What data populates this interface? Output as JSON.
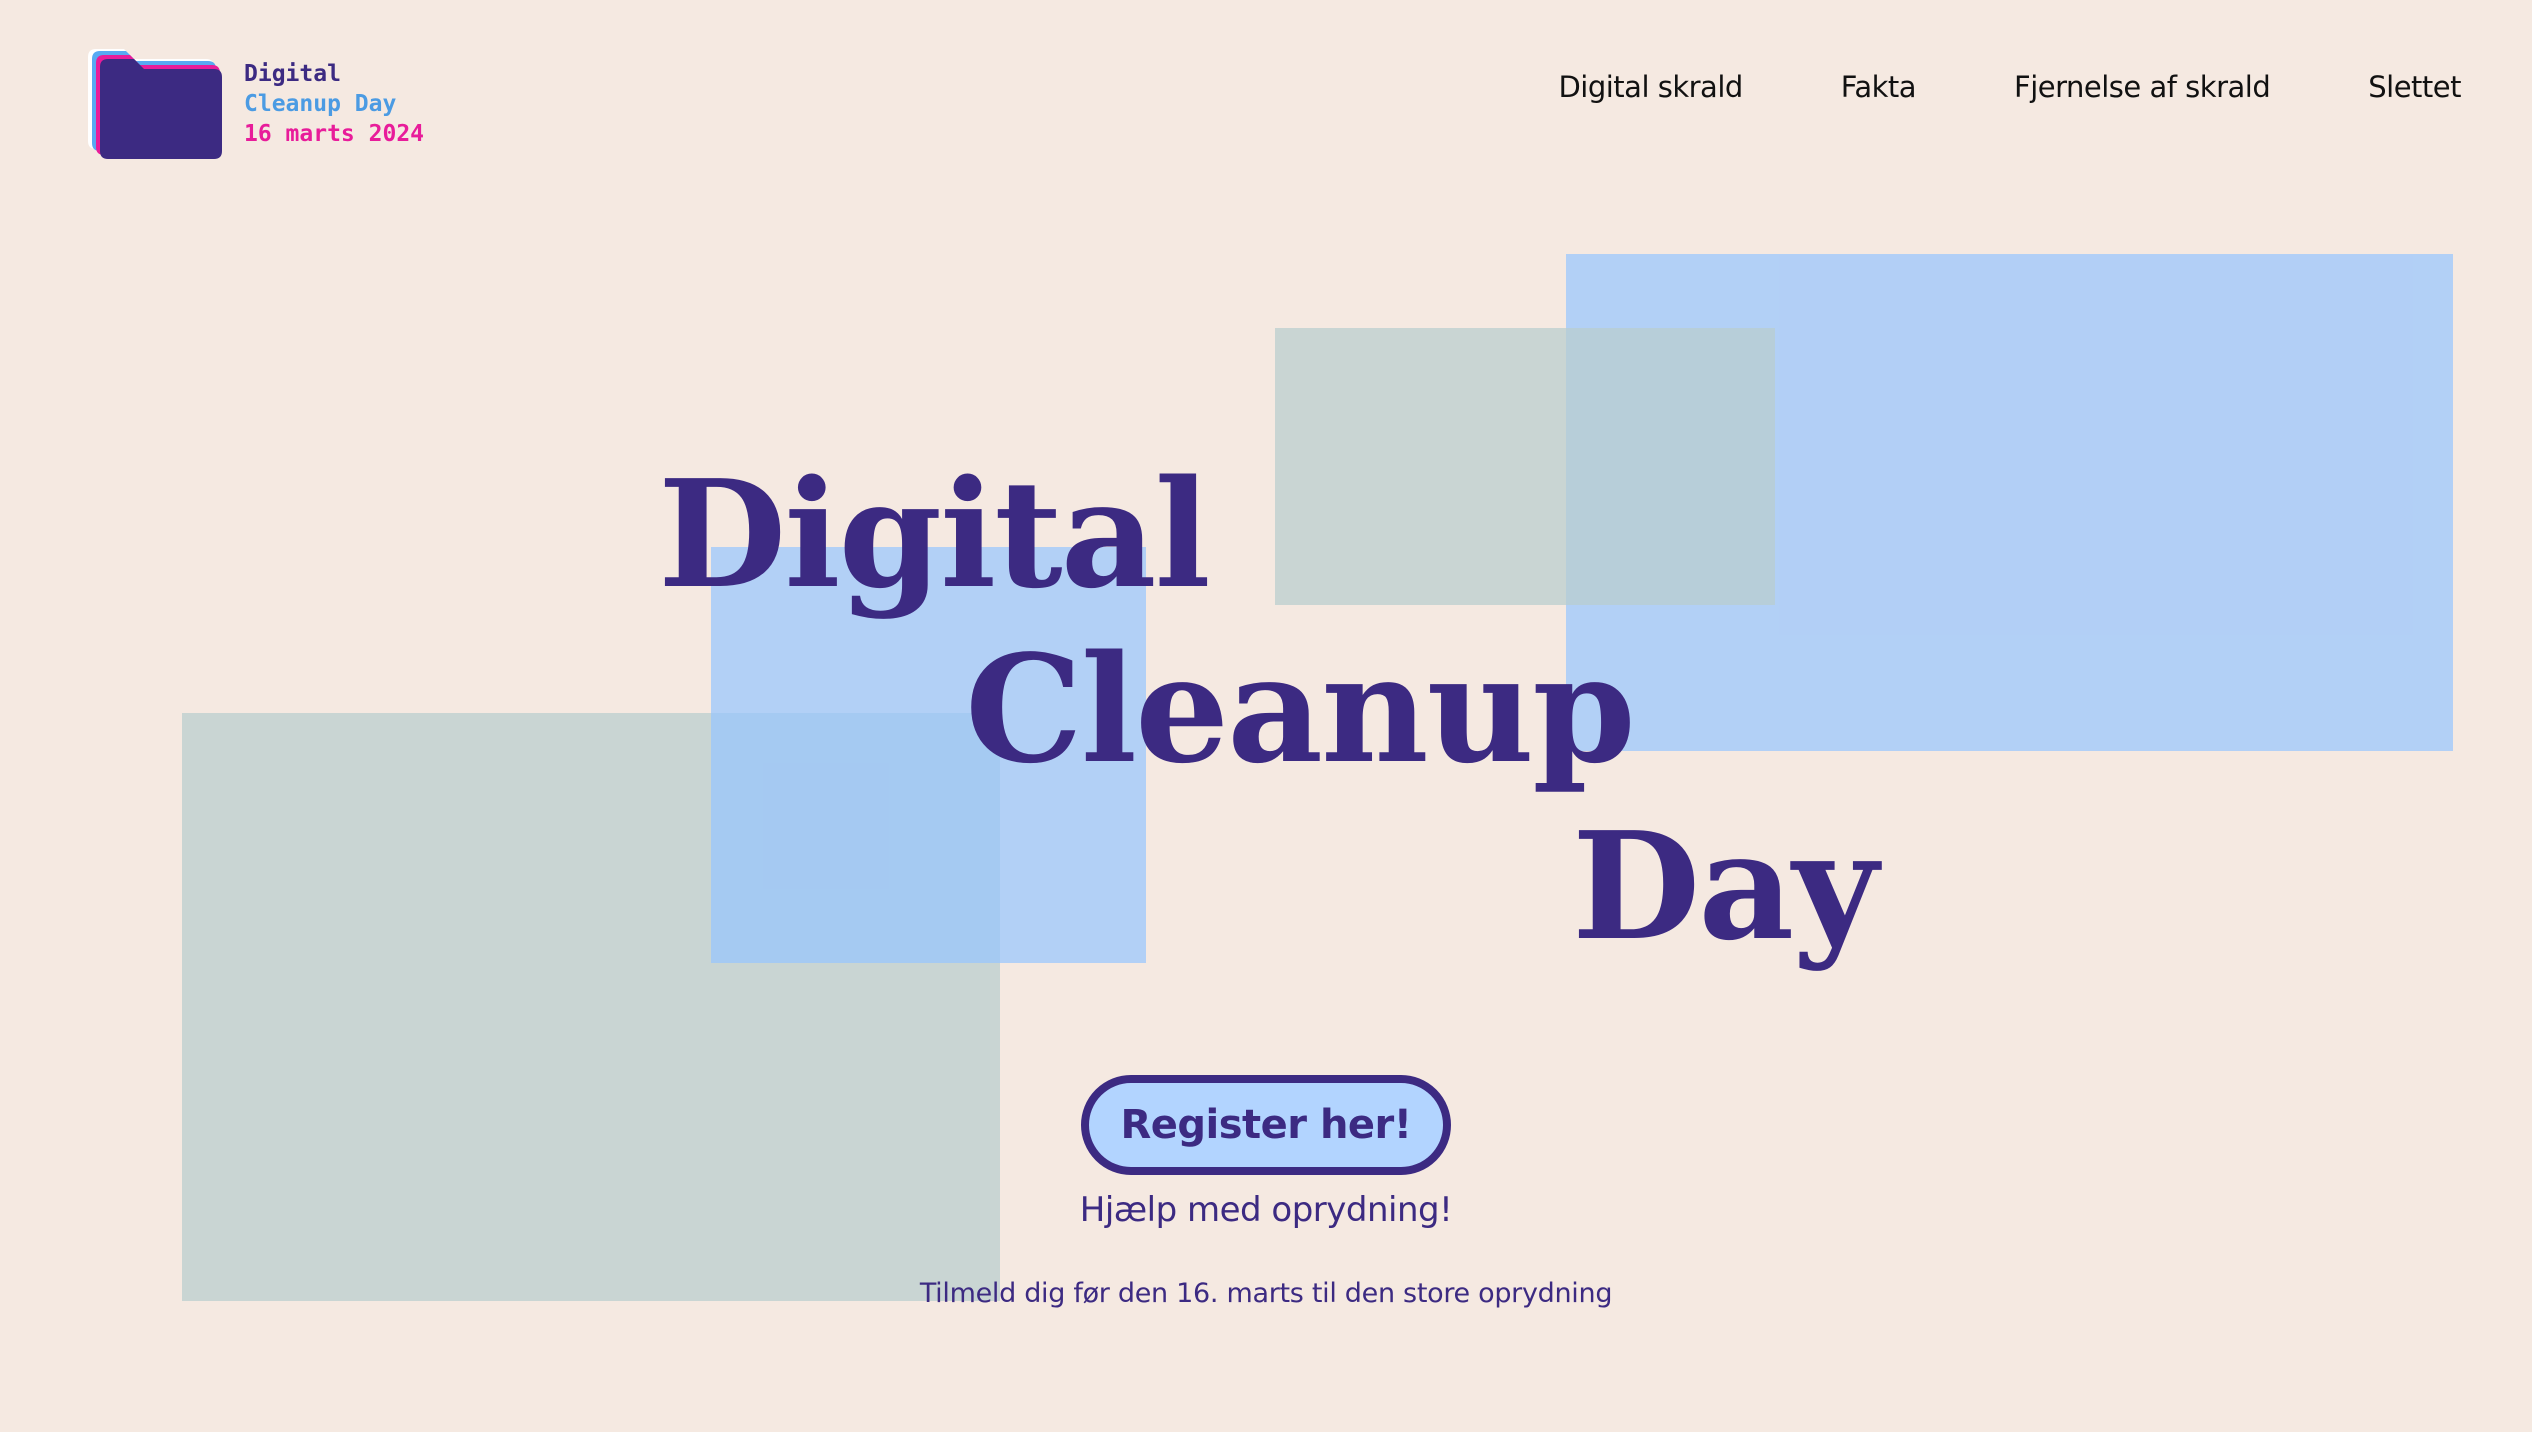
{
  "brand": {
    "line1": "Digital",
    "line2": "Cleanup Day",
    "line3": "16 marts 2024",
    "logo_icon": "folder-icon"
  },
  "nav": {
    "items": [
      {
        "label": "Digital skrald"
      },
      {
        "label": "Fakta"
      },
      {
        "label": "Fjernelse af skrald"
      },
      {
        "label": "Slettet"
      }
    ]
  },
  "hero": {
    "word1": "Digital",
    "word2": "Cleanup",
    "word3": "Day",
    "cta_label": "Register her!",
    "help_text": "Hjælp med oprydning!",
    "sub_text": "Tilmeld dig før den 16. marts til den store oprydning"
  },
  "colors": {
    "background": "#F5E9E1",
    "primary": "#3C2A82",
    "light_blue": "#B2D4FF",
    "gray_block": "#C6D3D3",
    "accent_blue": "#4B9BE3",
    "accent_pink": "#E81C9A"
  }
}
